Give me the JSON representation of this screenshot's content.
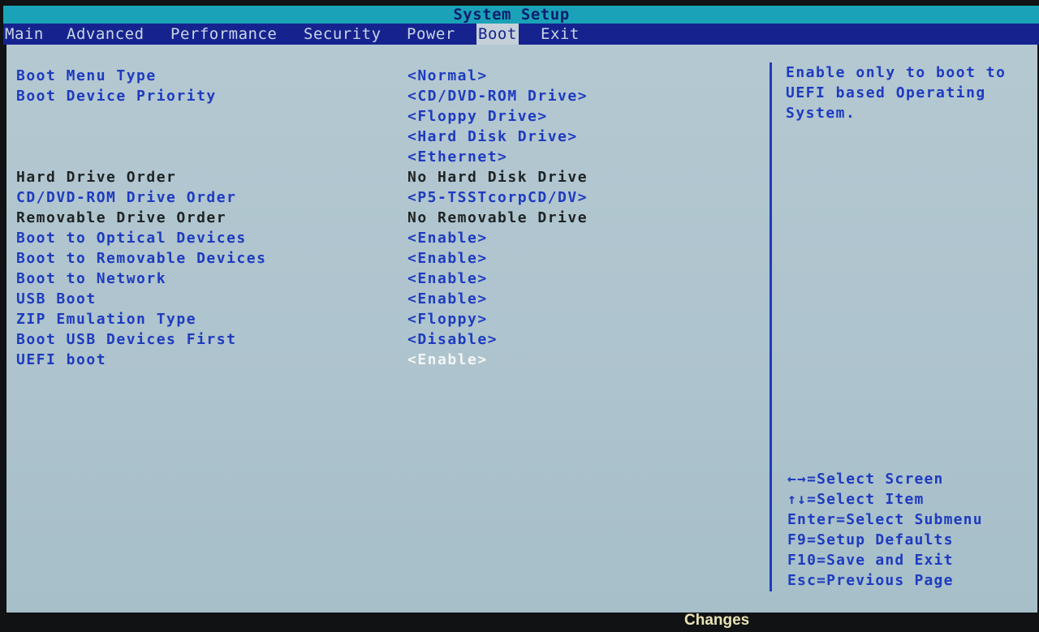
{
  "title": "System Setup",
  "tabs": [
    {
      "label": "Main",
      "active": false
    },
    {
      "label": "Advanced",
      "active": false
    },
    {
      "label": "Performance",
      "active": false
    },
    {
      "label": "Security",
      "active": false
    },
    {
      "label": "Power",
      "active": false
    },
    {
      "label": "Boot",
      "active": true
    },
    {
      "label": "Exit",
      "active": false
    }
  ],
  "settings": [
    {
      "label": "Boot Menu Type",
      "value": "<Normal>",
      "style": "blue",
      "selected": false
    },
    {
      "label": "Boot Device Priority",
      "value": "<CD/DVD-ROM Drive>",
      "style": "blue",
      "selected": false
    },
    {
      "label": "",
      "value": "<Floppy Drive>",
      "style": "blue",
      "selected": false
    },
    {
      "label": "",
      "value": "<Hard Disk Drive>",
      "style": "blue",
      "selected": false
    },
    {
      "label": "",
      "value": "<Ethernet>",
      "style": "blue",
      "selected": false
    },
    {
      "label": "Hard Drive Order",
      "value": "No Hard Disk Drive",
      "style": "dark",
      "selected": false
    },
    {
      "label": "CD/DVD-ROM Drive Order",
      "value": "<P5-TSSTcorpCD/DV>",
      "style": "blue",
      "selected": false
    },
    {
      "label": "Removable Drive Order",
      "value": "No Removable Drive",
      "style": "dark",
      "selected": false
    },
    {
      "label": "Boot to Optical Devices",
      "value": "<Enable>",
      "style": "blue",
      "selected": false
    },
    {
      "label": "Boot to Removable Devices",
      "value": "<Enable>",
      "style": "blue",
      "selected": false
    },
    {
      "label": "Boot to Network",
      "value": "<Enable>",
      "style": "blue",
      "selected": false
    },
    {
      "label": "USB Boot",
      "value": "<Enable>",
      "style": "blue",
      "selected": false
    },
    {
      "label": "ZIP Emulation Type",
      "value": "<Floppy>",
      "style": "blue",
      "selected": false
    },
    {
      "label": "Boot USB Devices First",
      "value": "<Disable>",
      "style": "blue",
      "selected": false
    },
    {
      "label": "UEFI boot",
      "value": "<Enable>",
      "style": "blue",
      "selected": true
    }
  ],
  "help": {
    "text": "Enable only to boot to UEFI based Operating System."
  },
  "keys": [
    "←→=Select Screen",
    "↑↓=Select Item",
    "Enter=Select Submenu",
    "F9=Setup Defaults",
    "F10=Save and Exit",
    "Esc=Previous Page"
  ],
  "status": {
    "text": "Changes"
  },
  "colors": {
    "title_bar": "#1aa3b8",
    "tab_bar": "#16238f",
    "panel": "#b1c6cf",
    "item_blue": "#1e3bbf",
    "item_dark": "#1e2324",
    "selected_value": "#f3f6f6",
    "status_text": "#e9e3b5"
  }
}
